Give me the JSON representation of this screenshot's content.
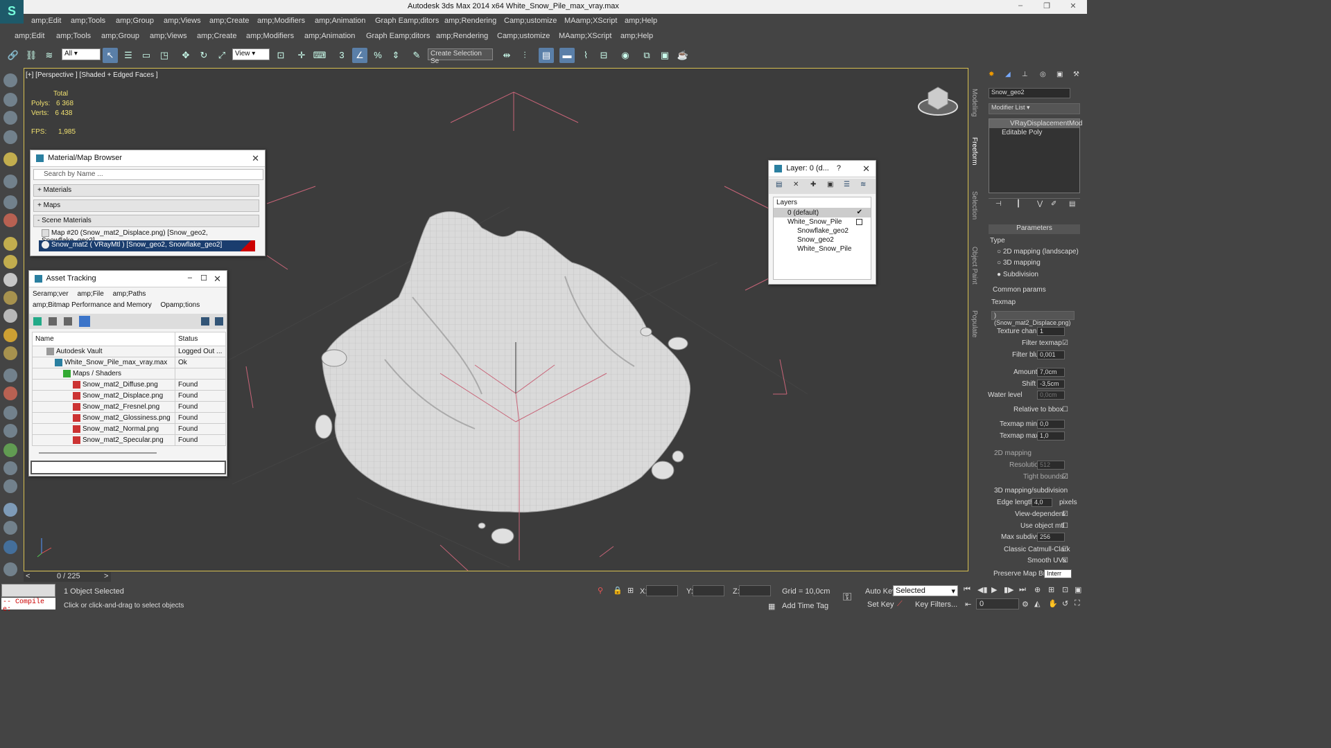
{
  "window": {
    "title": "Autodesk 3ds Max  2014 x64    White_Snow_Pile_max_vray.max"
  },
  "menu1": [
    "amp;Edit",
    "amp;Tools",
    "amp;Group",
    "amp;Views",
    "amp;Create",
    "amp;Modifiers",
    "amp;Animation",
    "Graph Eamp;ditors",
    "amp;Rendering",
    "Camp;ustomize",
    "MAamp;XScript",
    "amp;Help"
  ],
  "menu2": [
    "amp;Edit",
    "amp;Tools",
    "amp;Group",
    "amp;Views",
    "amp;Create",
    "amp;Modifiers",
    "amp;Animation",
    "Graph Eamp;ditors",
    "amp;Rendering",
    "Camp;ustomize",
    "MAamp;XScript",
    "amp;Help"
  ],
  "toolbar": {
    "filter": "All",
    "refcoord": "View",
    "selection_set": "Create Selection Se"
  },
  "viewport": {
    "label": "[+] [Perspective ] [Shaded + Edged Faces ]",
    "stats_total": "Total",
    "polys_label": "Polys:",
    "polys": "6 368",
    "verts_label": "Verts:",
    "verts": "6 438",
    "fps_label": "FPS:",
    "fps": "1,985"
  },
  "material_browser": {
    "title": "Material/Map Browser",
    "search": "Search by Name ...",
    "sections": [
      "+ Materials",
      "+ Maps",
      "- Scene Materials"
    ],
    "items": [
      "Map #20 (Snow_mat2_Displace.png)  [Snow_geo2, Snowflake_geo2]",
      "Snow_mat2  ( VRayMtl )  [Snow_geo2, Snowflake_geo2]"
    ]
  },
  "asset_tracking": {
    "title": "Asset Tracking",
    "menu": [
      "Seramp;ver",
      "amp;File",
      "amp;Paths",
      "amp;Bitmap Performance and Memory",
      "Opamp;tions"
    ],
    "col_name": "Name",
    "col_status": "Status",
    "rows": [
      [
        "Autodesk Vault",
        "Logged Out ..."
      ],
      [
        "White_Snow_Pile_max_vray.max",
        "Ok"
      ],
      [
        "Maps / Shaders",
        ""
      ],
      [
        "Snow_mat2_Diffuse.png",
        "Found"
      ],
      [
        "Snow_mat2_Displace.png",
        "Found"
      ],
      [
        "Snow_mat2_Fresnel.png",
        "Found"
      ],
      [
        "Snow_mat2_Glossiness.png",
        "Found"
      ],
      [
        "Snow_mat2_Normal.png",
        "Found"
      ],
      [
        "Snow_mat2_Specular.png",
        "Found"
      ]
    ]
  },
  "layer_panel": {
    "title": "Layer: 0 (d...",
    "help": "?",
    "header": "Layers",
    "items": [
      "0 (default)",
      "White_Snow_Pile",
      "Snowflake_geo2",
      "Snow_geo2",
      "White_Snow_Pile"
    ]
  },
  "side_tabs": [
    "Modeling",
    "Freeform",
    "Selection",
    "Object Paint",
    "Populate"
  ],
  "command_panel": {
    "object_name": "Snow_geo2",
    "modifier_list": "Modifier List",
    "stack": [
      "VRayDisplacementMod",
      "Editable Poly"
    ],
    "parameters": "Parameters",
    "type_label": "Type",
    "type_options": [
      "2D mapping (landscape)",
      "3D mapping",
      "Subdivision"
    ],
    "common_params": "Common params",
    "texmap_label": "Texmap",
    "texmap_value": ") (Snow_mat2_Displace.png)",
    "fields": [
      [
        "Texture chan",
        "1"
      ],
      [
        "Filter texmap",
        ""
      ],
      [
        "Filter blur",
        "0,001"
      ],
      [
        "Amount",
        "7,0cm"
      ],
      [
        "Shift",
        "-3,5cm"
      ],
      [
        "Water level",
        "0,0cm"
      ],
      [
        "Relative to bbox",
        ""
      ],
      [
        "Texmap min",
        "0,0"
      ],
      [
        "Texmap max",
        "1,0"
      ]
    ],
    "mapping2d": "2D mapping",
    "resolution_label": "Resolution",
    "resolution": "512",
    "tight_bounds": "Tight bounds",
    "mapping3d": "3D mapping/subdivision",
    "edge_length_label": "Edge length",
    "edge_length": "4,0",
    "pixels": "pixels",
    "view_dependent": "View-dependent",
    "use_object_mtl": "Use object mtl",
    "max_subdivs_label": "Max subdivs",
    "max_subdivs": "256",
    "catmull": "Classic Catmull-Clark",
    "smooth_uvs": "Smooth UVs",
    "preserve_map_bnd": "Preserve Map Bnd",
    "preserve_value": "Interr"
  },
  "timeline": {
    "frame": "0 / 225"
  },
  "status": {
    "maxscript": "-- Compile e:",
    "selected": "1 Object Selected",
    "prompt": "Click or click-and-drag to select objects",
    "x": "X:",
    "y": "Y:",
    "z": "Z:",
    "grid": "Grid = 10,0cm",
    "add_time_tag": "Add Time Tag",
    "auto_key": "Auto Key",
    "set_key": "Set Key",
    "selected_dropdown": "Selected",
    "key_filters": "Key Filters...",
    "frame_value": "0"
  }
}
